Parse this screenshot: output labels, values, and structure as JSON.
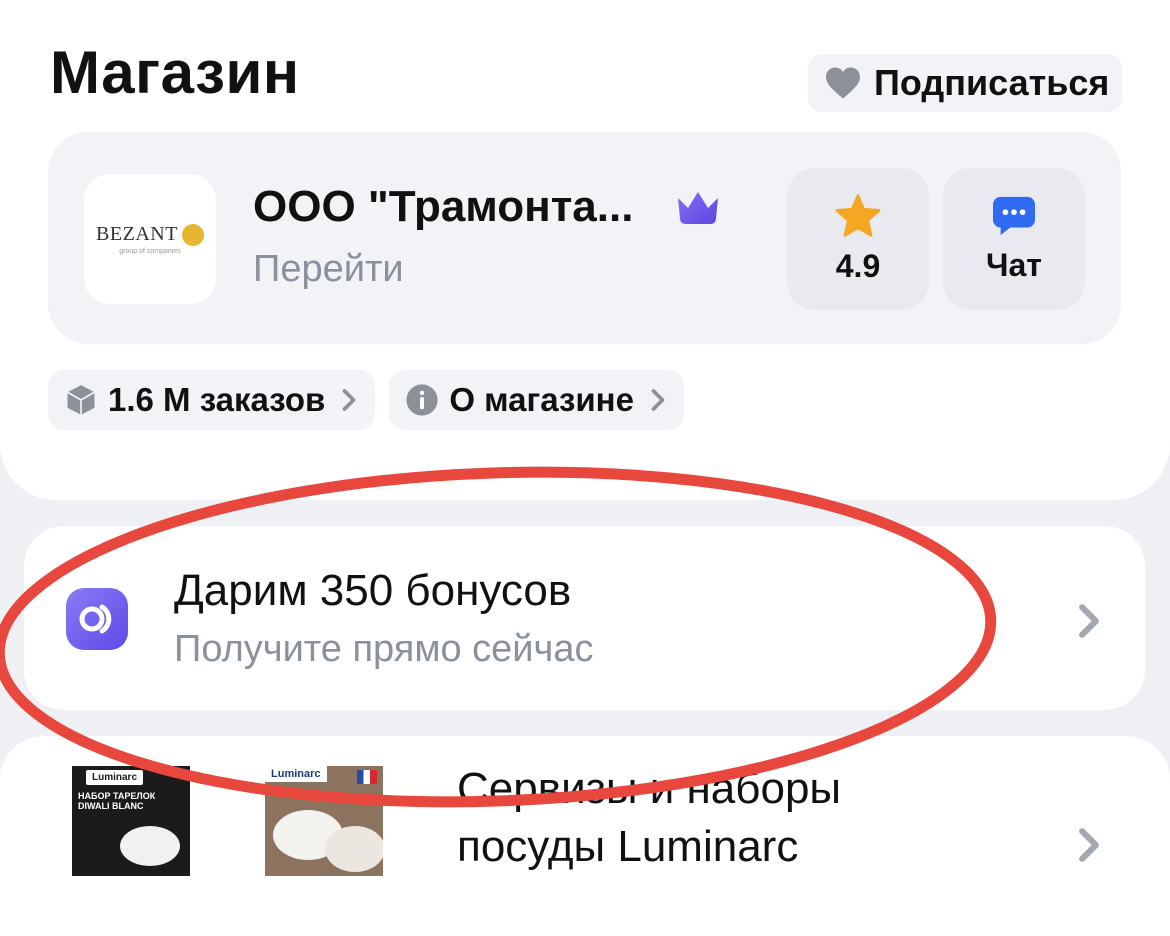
{
  "header": {
    "title": "Магазин",
    "subscribe_label": "Подписаться"
  },
  "seller": {
    "logo_text": "BEZANT",
    "logo_subtext": "group of companies",
    "name": "ООО \"Трамонта...",
    "link_label": "Перейти",
    "rating": "4.9",
    "chat_label": "Чат"
  },
  "chips": [
    {
      "label": "1.6 М заказов",
      "icon": "box-icon"
    },
    {
      "label": "О магазине",
      "icon": "info-icon"
    }
  ],
  "bonus": {
    "title": "Дарим 350 бонусов",
    "subtitle": "Получите прямо сейчас",
    "icon": "bonus-logo-icon"
  },
  "collection": {
    "title_line1": "Сервизы и наборы",
    "title_line2": "посуды Luminarc",
    "thumb1": {
      "brand": "Luminarc",
      "text": "НАБОР ТАРЕЛОК DIWALI BLANC"
    },
    "thumb2": {
      "brand": "Luminarc"
    }
  },
  "colors": {
    "accent_purple": "#6e5ce8",
    "star": "#f5a623",
    "chat_blue": "#2f6bf0",
    "annotation_red": "#e8473d"
  }
}
